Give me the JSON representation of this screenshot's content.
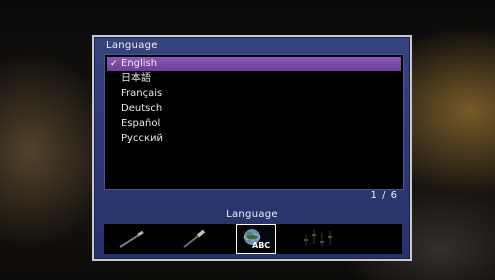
{
  "menu": {
    "title": "Language",
    "selected_index": 0,
    "items": [
      {
        "label": "English",
        "selected": true
      },
      {
        "label": "日本語"
      },
      {
        "label": "Français"
      },
      {
        "label": "Deutsch"
      },
      {
        "label": "Español"
      },
      {
        "label": "Русский"
      }
    ],
    "checkmark": "✓",
    "page_indicator": "1 / 6"
  },
  "footer": {
    "section_label": "Language",
    "icons": [
      {
        "name": "speaker-wand-icon"
      },
      {
        "name": "remote-wand-icon"
      },
      {
        "name": "globe-abc-icon",
        "text": "ABC",
        "active": true
      },
      {
        "name": "equalizer-icon"
      }
    ]
  },
  "colors": {
    "panel_bg": "#2c3a72",
    "selection": "#7a48a8",
    "list_bg": "#000000",
    "text": "#f0f0f4"
  }
}
